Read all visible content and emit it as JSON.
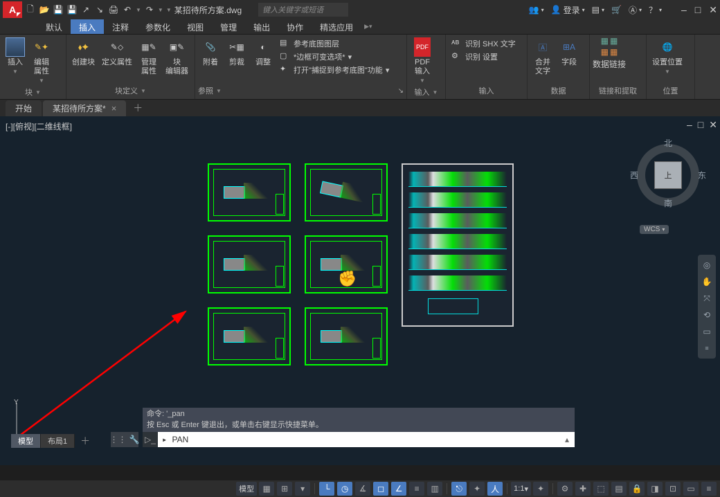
{
  "title_bar": {
    "file_name": "某招待所方案.dwg",
    "search_placeholder": "键入关键字或短语",
    "login_label": "登录",
    "qat_share_icon": "share-icon",
    "qat_login_icon": "user-icon",
    "help_icon": "help-icon"
  },
  "ribbon_tabs": [
    "默认",
    "插入",
    "注释",
    "参数化",
    "视图",
    "管理",
    "输出",
    "协作",
    "精选应用"
  ],
  "ribbon_active_index": 1,
  "ribbon": {
    "panel_block": {
      "insert_label": "插入",
      "edit_attr_label": "编辑\n属性",
      "create_label": "创建块",
      "def_attr_label": "定义属性",
      "manage_attr_label": "管理\n属性",
      "block_editor_label": "块\n编辑器",
      "panel1_label": "块",
      "panel2_label": "块定义"
    },
    "panel_ref": {
      "attach_label": "附着",
      "clip_label": "剪裁",
      "adjust_label": "调整",
      "item1": "参考底图图层",
      "item2": "*边框可变选项*",
      "item3": "打开\"捕捉到参考底图\"功能",
      "panel_label": "参照"
    },
    "panel_pdf": {
      "label": "PDF\n输入",
      "panel_label": "输入"
    },
    "panel_recog": {
      "item1": "识别 SHX 文字",
      "item2": "识别 设置",
      "panel_label": "输入"
    },
    "panel_text": {
      "merge_label": "合并\n文字",
      "field_label": "字段",
      "panel_label": "数据"
    },
    "panel_data": {
      "link_label": "数据链接",
      "panel_label": "链接和提取"
    },
    "panel_loc": {
      "label": "设置位置",
      "panel_label": "位置"
    }
  },
  "file_tabs": {
    "start": "开始",
    "active": "某招待所方案*"
  },
  "view": {
    "label": "[-][俯视][二维线框]",
    "viewcube": {
      "n": "北",
      "s": "南",
      "e": "东",
      "w": "西",
      "face": "上",
      "wcs": "WCS"
    }
  },
  "command": {
    "history1": "命令: '_pan",
    "history2": "按 Esc 或 Enter 键退出，或单击右键显示快捷菜单。",
    "prompt": "PAN"
  },
  "layout_tabs": {
    "model": "模型",
    "layout1": "布局1"
  },
  "status": {
    "model_btn": "模型",
    "scale": "1:1"
  }
}
